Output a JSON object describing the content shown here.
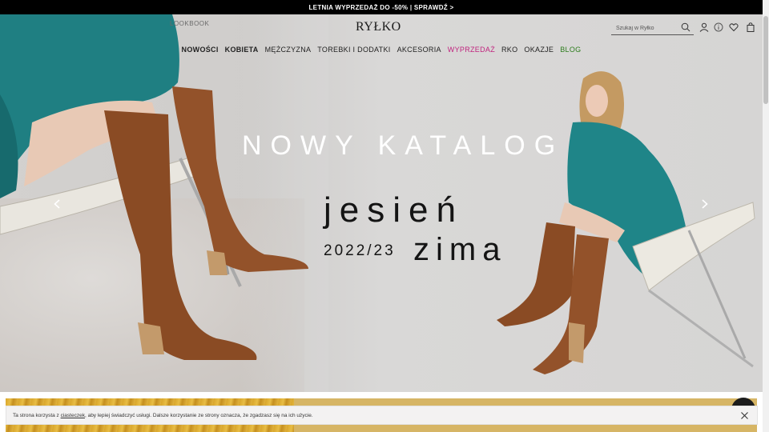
{
  "promo_bar": {
    "text": "LETNIA WYPRZEDAŻ DO -50% | SPRAWDŹ >"
  },
  "header": {
    "lookbook": "LOOKBOOK",
    "logo": "RYŁKO",
    "search_placeholder": "Szukaj w Ryłko",
    "icons": [
      "user-icon",
      "info-icon",
      "heart-icon",
      "bag-icon"
    ]
  },
  "nav": {
    "items": [
      {
        "label": "NOWOŚCI"
      },
      {
        "label": "KOBIETA"
      },
      {
        "label": "MĘŻCZYZNA"
      },
      {
        "label": "TOREBKI I DODATKI"
      },
      {
        "label": "AKCESORIA"
      },
      {
        "label": "WYPRZEDAŻ"
      },
      {
        "label": "RKO"
      },
      {
        "label": "OKAZJE"
      },
      {
        "label": "BLOG"
      }
    ],
    "sale_color": "#c0237e",
    "blog_color": "#2e7d1e"
  },
  "hero": {
    "title": "NOWY KATALOG",
    "line1": "jesień",
    "year": "2022/23",
    "line2": "zima",
    "prev_icon": "chevron-left-icon",
    "next_icon": "chevron-right-icon"
  },
  "cookie": {
    "text_before": "Ta strona korzysta z ",
    "link": "ciasteczek",
    "text_after": ", aby lepiej świadczyć usługi. Dalsze korzystanie ze strony oznacza, że zgadzasz się na ich użycie."
  }
}
